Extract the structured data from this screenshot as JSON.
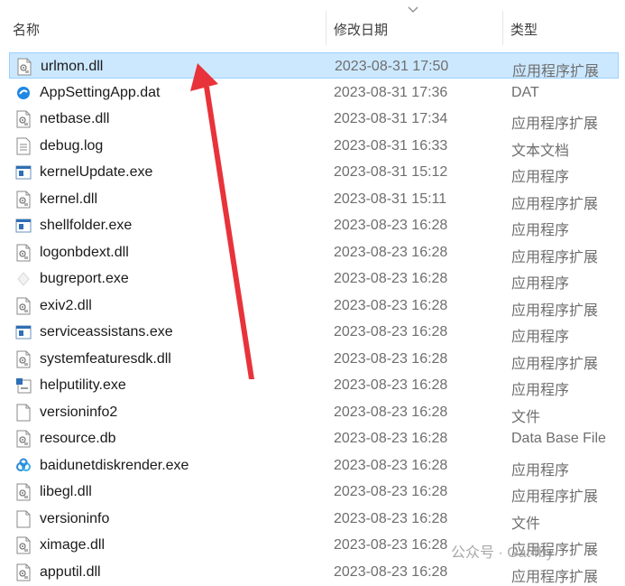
{
  "header": {
    "name_label": "名称",
    "date_label": "修改日期",
    "type_label": "类型"
  },
  "files": [
    {
      "name": "urlmon.dll",
      "date": "2023-08-31 17:50",
      "type": "应用程序扩展",
      "icon": "dll-icon",
      "selected": true
    },
    {
      "name": "AppSettingApp.dat",
      "date": "2023-08-31 17:36",
      "type": "DAT",
      "icon": "blue-app-icon",
      "selected": false
    },
    {
      "name": "netbase.dll",
      "date": "2023-08-31 17:34",
      "type": "应用程序扩展",
      "icon": "dll-icon",
      "selected": false
    },
    {
      "name": "debug.log",
      "date": "2023-08-31 16:33",
      "type": "文本文档",
      "icon": "text-file-icon",
      "selected": false
    },
    {
      "name": "kernelUpdate.exe",
      "date": "2023-08-31 15:12",
      "type": "应用程序",
      "icon": "exe-icon",
      "selected": false
    },
    {
      "name": "kernel.dll",
      "date": "2023-08-31 15:11",
      "type": "应用程序扩展",
      "icon": "dll-icon",
      "selected": false
    },
    {
      "name": "shellfolder.exe",
      "date": "2023-08-23 16:28",
      "type": "应用程序",
      "icon": "exe-icon",
      "selected": false
    },
    {
      "name": "logonbdext.dll",
      "date": "2023-08-23 16:28",
      "type": "应用程序扩展",
      "icon": "dll-icon",
      "selected": false
    },
    {
      "name": "bugreport.exe",
      "date": "2023-08-23 16:28",
      "type": "应用程序",
      "icon": "faded-app-icon",
      "selected": false
    },
    {
      "name": "exiv2.dll",
      "date": "2023-08-23 16:28",
      "type": "应用程序扩展",
      "icon": "dll-icon",
      "selected": false
    },
    {
      "name": "serviceassistans.exe",
      "date": "2023-08-23 16:28",
      "type": "应用程序",
      "icon": "exe-icon",
      "selected": false
    },
    {
      "name": "systemfeaturesdk.dll",
      "date": "2023-08-23 16:28",
      "type": "应用程序扩展",
      "icon": "dll-icon",
      "selected": false
    },
    {
      "name": "helputility.exe",
      "date": "2023-08-23 16:28",
      "type": "应用程序",
      "icon": "setup-exe-icon",
      "selected": false
    },
    {
      "name": "versioninfo2",
      "date": "2023-08-23 16:28",
      "type": "文件",
      "icon": "blank-file-icon",
      "selected": false
    },
    {
      "name": "resource.db",
      "date": "2023-08-23 16:28",
      "type": "Data Base File",
      "icon": "dll-icon",
      "selected": false
    },
    {
      "name": "baidunetdiskrender.exe",
      "date": "2023-08-23 16:28",
      "type": "应用程序",
      "icon": "cloud-app-icon",
      "selected": false
    },
    {
      "name": "libegl.dll",
      "date": "2023-08-23 16:28",
      "type": "应用程序扩展",
      "icon": "dll-icon",
      "selected": false
    },
    {
      "name": "versioninfo",
      "date": "2023-08-23 16:28",
      "type": "文件",
      "icon": "blank-file-icon",
      "selected": false
    },
    {
      "name": "ximage.dll",
      "date": "2023-08-23 16:28",
      "type": "应用程序扩展",
      "icon": "dll-icon",
      "selected": false
    },
    {
      "name": "apputil.dll",
      "date": "2023-08-23 16:28",
      "type": "应用程序扩展",
      "icon": "dll-icon",
      "selected": false
    }
  ],
  "watermark": "公众号 · Gat4by",
  "colors": {
    "selection_bg": "#cce8ff",
    "selection_border": "#99d1ff",
    "arrow": "#e8333a"
  }
}
